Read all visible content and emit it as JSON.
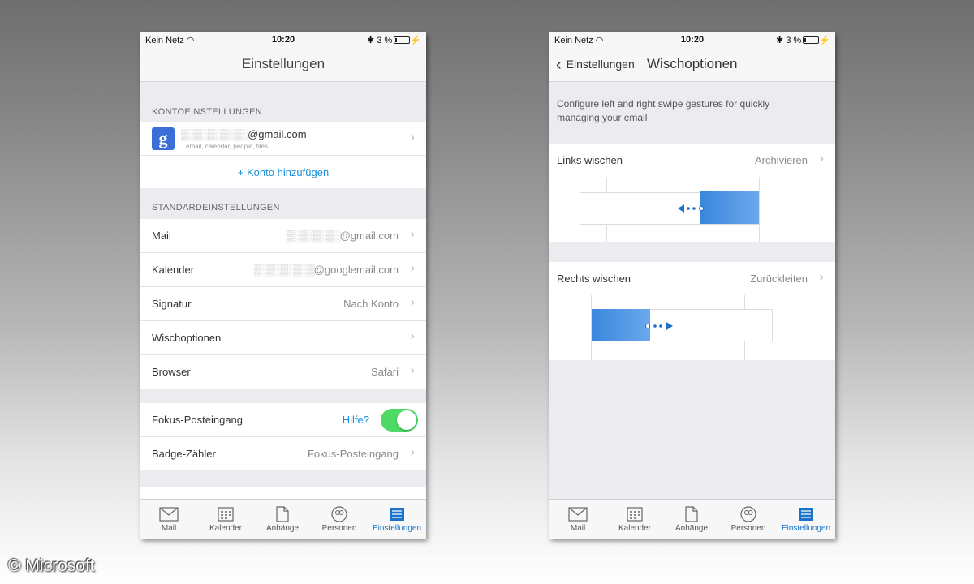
{
  "status": {
    "carrier": "Kein Netz",
    "time": "10:20",
    "battery": "3 %"
  },
  "left": {
    "title": "Einstellungen",
    "account_header": "KONTOEINSTELLUNGEN",
    "account": {
      "email_suffix": "@gmail.com",
      "subtitle": "email, calendar, people, files",
      "icon": "google-icon"
    },
    "add_account": "+ Konto hinzufügen",
    "defaults_header": "STANDARDEINSTELLUNGEN",
    "rows": [
      {
        "label": "Mail",
        "value": "@gmail.com"
      },
      {
        "label": "Kalender",
        "value": "@googlemail.com"
      },
      {
        "label": "Signatur",
        "value": "Nach Konto"
      },
      {
        "label": "Wischoptionen",
        "value": ""
      },
      {
        "label": "Browser",
        "value": "Safari"
      }
    ],
    "focus": {
      "label": "Fokus-Posteingang",
      "help": "Hilfe?",
      "enabled": true
    },
    "badge": {
      "label": "Badge-Zähler",
      "value": "Fokus-Posteingang"
    }
  },
  "right": {
    "back_label": "Einstellungen",
    "title": "Wischoptionen",
    "description": "Configure left and right swipe gestures for quickly managing your email",
    "left_swipe": {
      "label": "Links wischen",
      "value": "Archivieren"
    },
    "right_swipe": {
      "label": "Rechts wischen",
      "value": "Zurückleiten"
    }
  },
  "tabs": [
    {
      "label": "Mail",
      "icon": "mail-icon"
    },
    {
      "label": "Kalender",
      "icon": "calendar-icon"
    },
    {
      "label": "Anhänge",
      "icon": "file-icon"
    },
    {
      "label": "Personen",
      "icon": "people-icon"
    },
    {
      "label": "Einstellungen",
      "icon": "settings-icon",
      "active": true
    }
  ],
  "colors": {
    "accent": "#1a73c9",
    "toggle_on": "#4cd964",
    "swipe_blue": "#3b86dd"
  },
  "copyright": "© Microsoft"
}
